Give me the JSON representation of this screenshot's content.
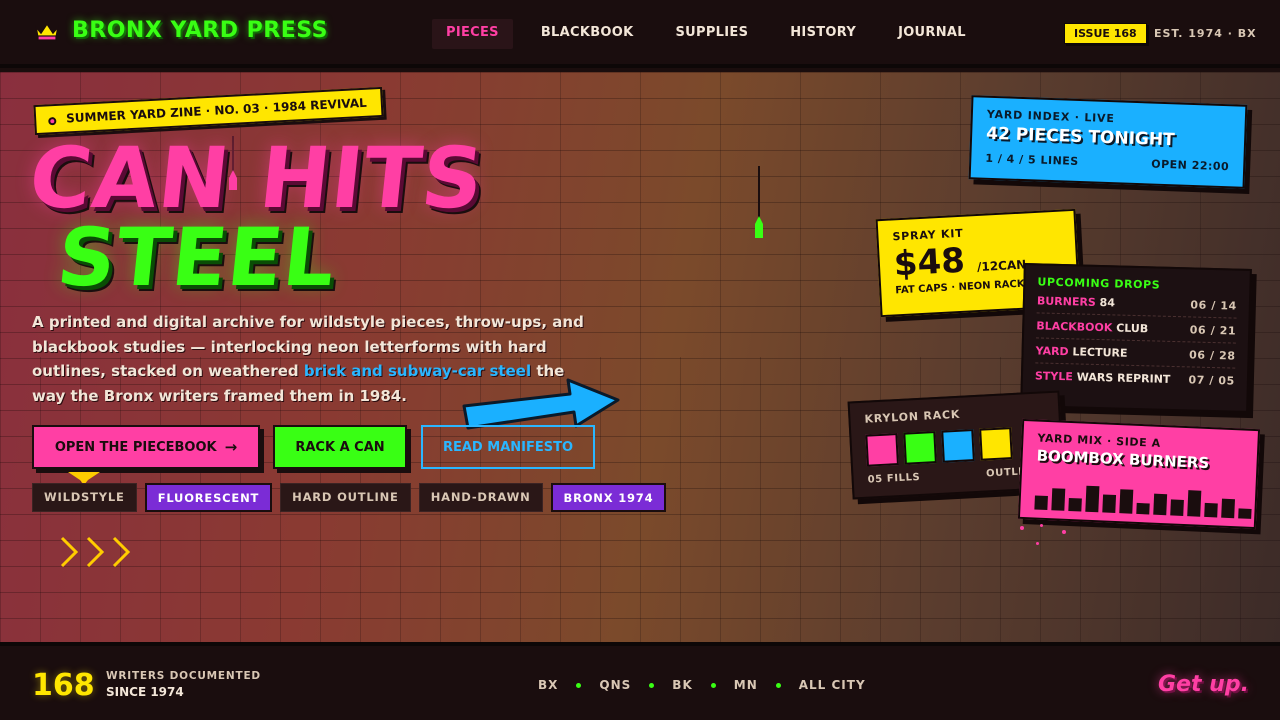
{
  "brand": {
    "name": "BRONX YARD PRESS",
    "icon": "crown-icon"
  },
  "nav": {
    "items": [
      "PIECES",
      "BLACKBOOK",
      "SUPPLIES",
      "HISTORY",
      "JOURNAL"
    ],
    "active_index": 0,
    "issue": "ISSUE 168",
    "est": "EST. 1974 · BX"
  },
  "hero": {
    "tag": "SUMMER YARD ZINE · NO. 03 · 1984 REVIVAL",
    "headline_1": "CAN HITS",
    "headline_2": "STEEL",
    "lede_start": "A printed and digital archive for wildstyle pieces, throw-ups, and blackbook studies — interlocking neon letterforms with hard outlines, stacked on weathered ",
    "lede_highlight": "brick and subway-car steel",
    "lede_end": " the way the Bronx writers framed them in 1984.",
    "cta_open": "OPEN THE PIECEBOOK",
    "cta_open_icon": "arrow-right-icon",
    "cta_rack": "RACK A CAN",
    "cta_read": "READ MANIFESTO",
    "chips": [
      "WILDSTYLE",
      "FLUORESCENT",
      "HARD OUTLINE",
      "HAND-DRAWN",
      "BRONX 1974"
    ],
    "chip_highlights": [
      1,
      4
    ]
  },
  "cards": {
    "index": {
      "eyebrow": "YARD INDEX · LIVE",
      "title": "42 PIECES TONIGHT",
      "lines": "1 / 4 / 5 LINES",
      "open": "OPEN 22:00"
    },
    "kit": {
      "eyebrow": "SPRAY KIT",
      "price": "$48",
      "unit": "/12CAN",
      "sub": "FAT CAPS · NEON RACK"
    },
    "drops": {
      "title": "UPCOMING DROPS",
      "rows": [
        {
          "key": "BURNERS",
          "rest": " 84",
          "date": "06 / 14"
        },
        {
          "key": "BLACKBOOK",
          "rest": " CLUB",
          "date": "06 / 21"
        },
        {
          "key": "YARD",
          "rest": " LECTURE",
          "date": "06 / 28"
        },
        {
          "key": "STYLE",
          "rest": " WARS REPRINT",
          "date": "07 / 05"
        }
      ]
    },
    "rack": {
      "title": "KRYLON RACK",
      "swatches": [
        "#ff3fa4",
        "#39ff14",
        "#1ab0ff",
        "#ffe600"
      ],
      "fills": "05 FILLS",
      "outline": "OUTLINE ·"
    },
    "mix": {
      "eyebrow": "YARD MIX · SIDE A",
      "title": "BOOMBOX BURNERS",
      "levels": [
        0.45,
        0.7,
        0.4,
        0.8,
        0.55,
        0.75,
        0.35,
        0.65,
        0.5,
        0.8,
        0.45,
        0.6,
        0.3
      ]
    }
  },
  "footer": {
    "count": "168",
    "label_1": "WRITERS DOCUMENTED",
    "label_2": "SINCE 1974",
    "boroughs": [
      "BX",
      "QNS",
      "BK",
      "MN",
      "ALL CITY"
    ],
    "signoff": "Get up."
  },
  "colors": {
    "pink": "#ff3fa4",
    "green": "#39ff14",
    "blue": "#1ab0ff",
    "yellow": "#ffe600",
    "bg": "#1a0d0e"
  }
}
